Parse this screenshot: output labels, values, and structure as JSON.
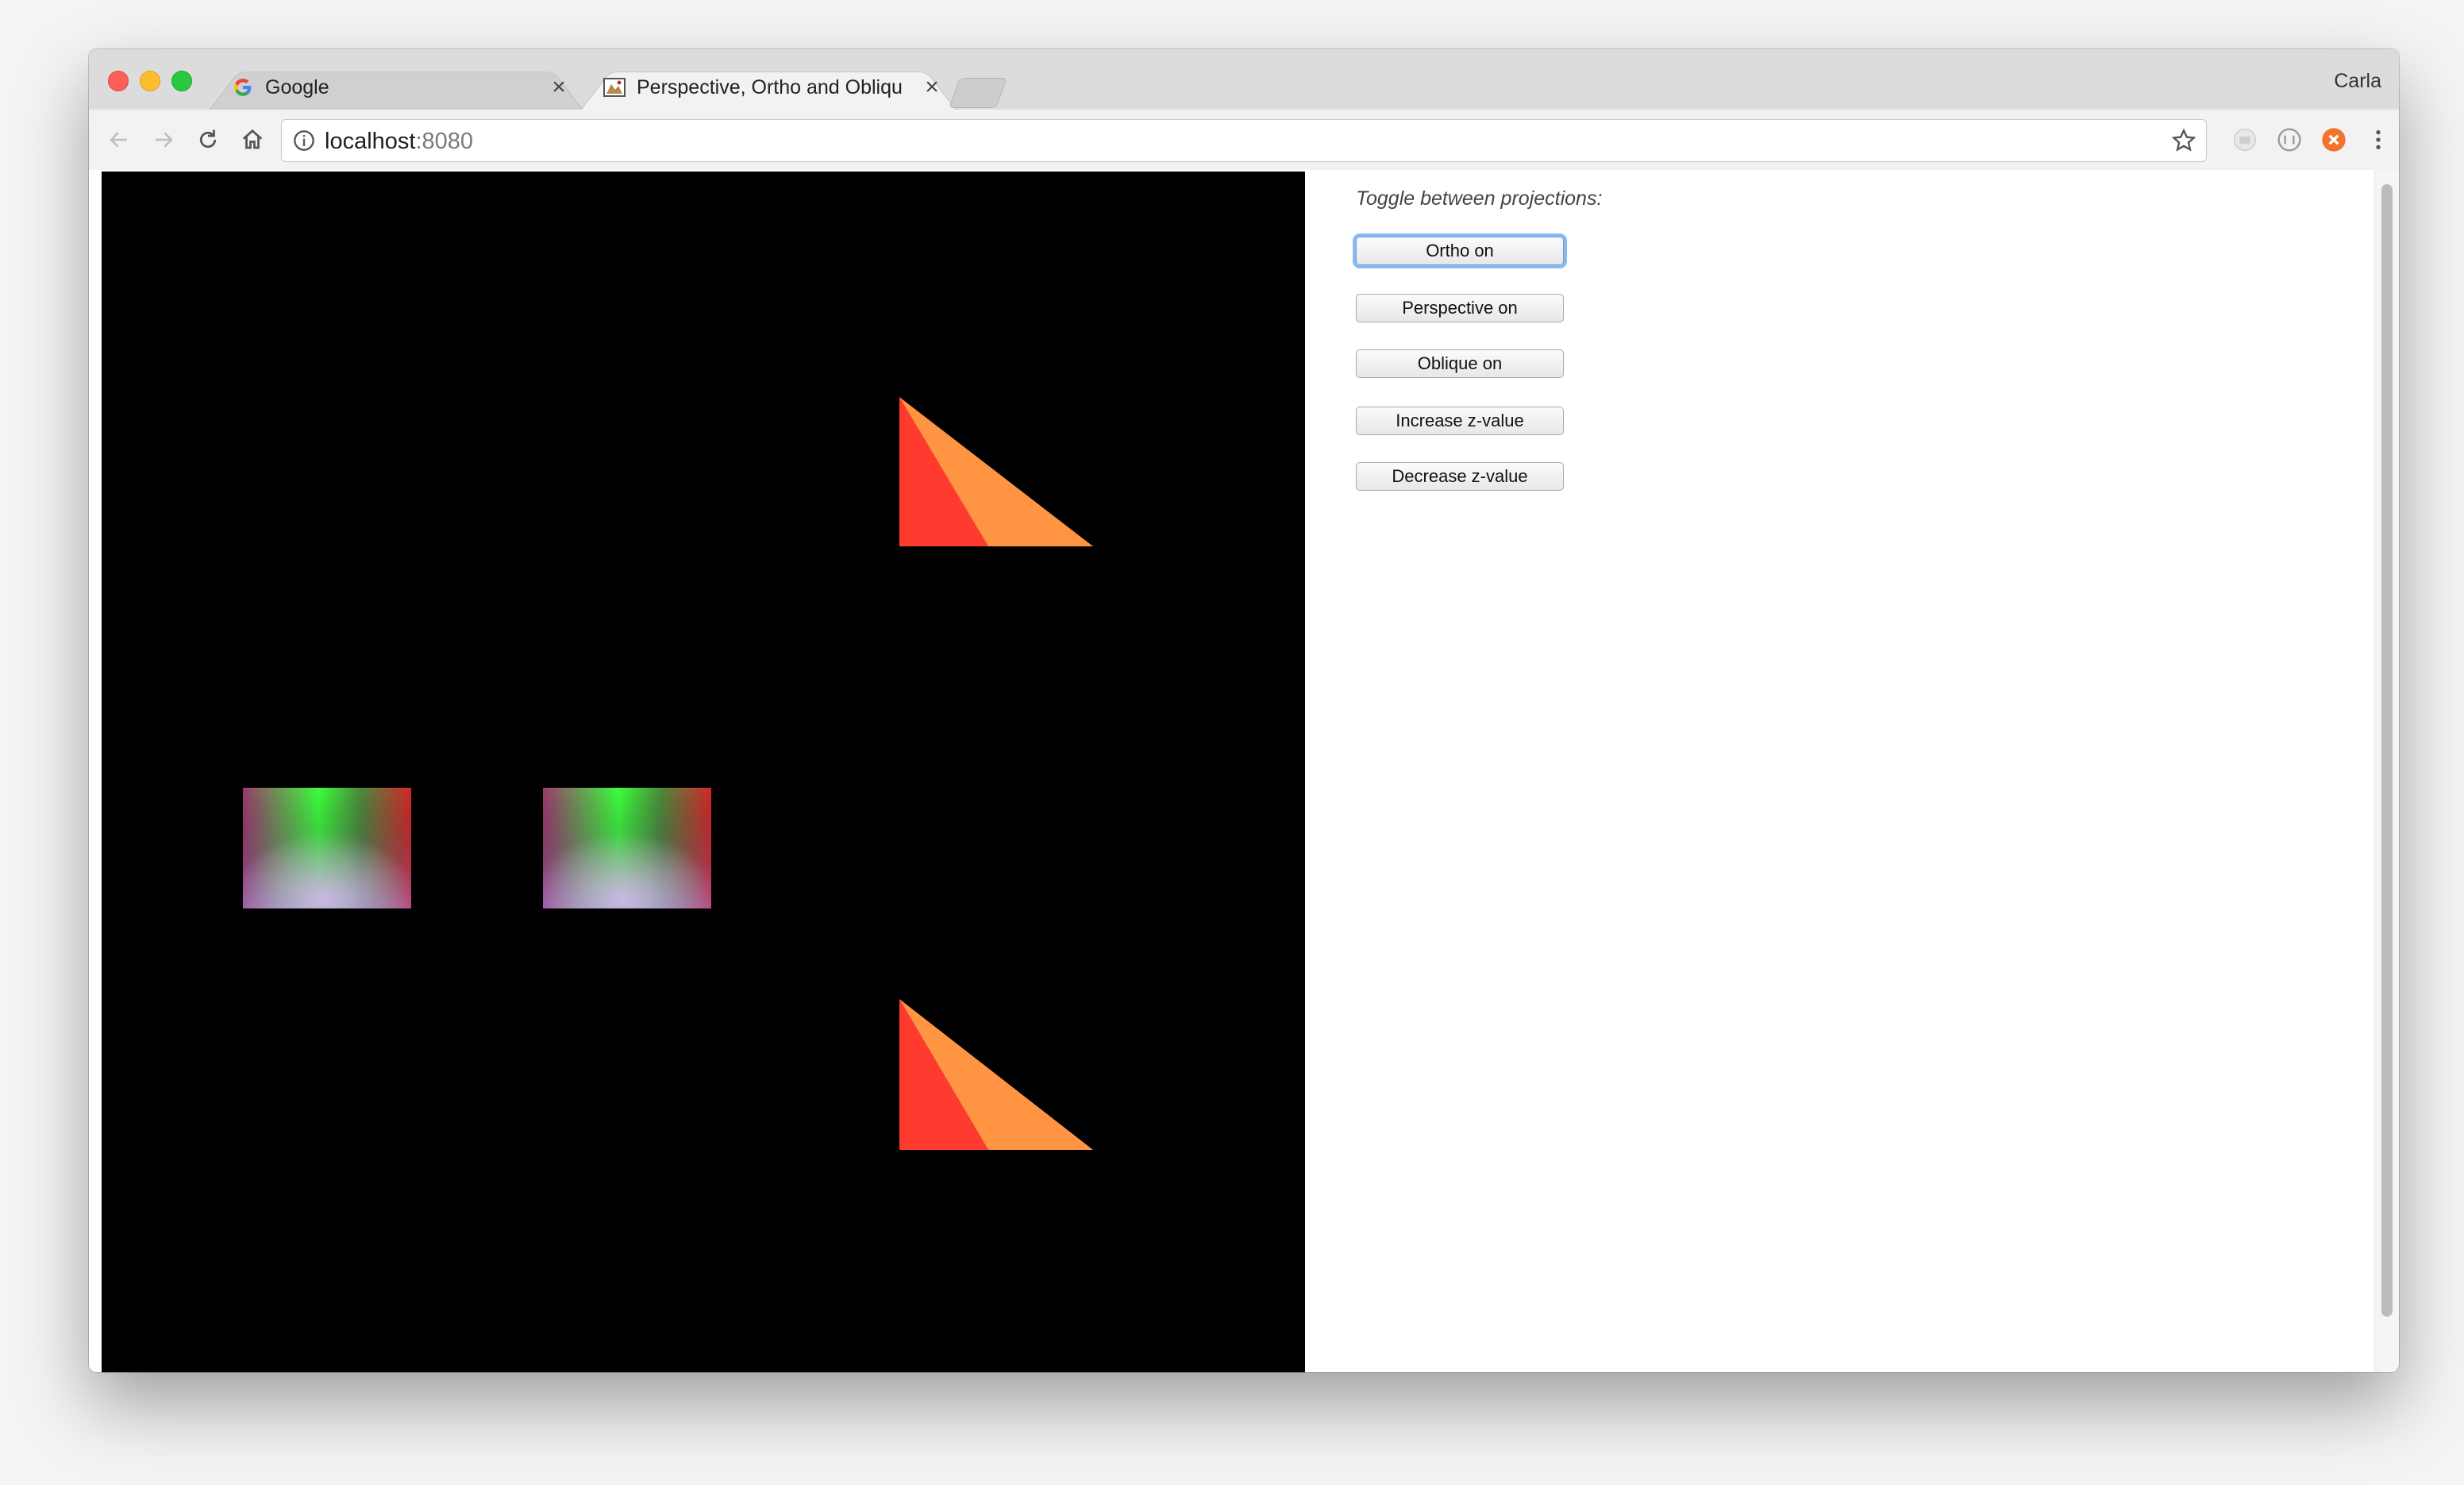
{
  "browser": {
    "tabs": [
      {
        "title": "Google",
        "favicon": "google-g-icon",
        "active": false
      },
      {
        "title": "Perspective, Ortho and Obliqu",
        "favicon": "page-thumbnail-icon",
        "active": true
      }
    ],
    "profile_name": "Carla",
    "address": {
      "host": "localhost",
      "port": ":8080"
    },
    "icons": {
      "back": "arrow-left-icon",
      "forward": "arrow-right-icon",
      "reload": "reload-icon",
      "home": "home-icon",
      "info": "info-icon",
      "bookmark": "star-icon",
      "extensions": [
        "extension-gray-icon",
        "extension-circle-icon",
        "extension-orange-icon"
      ],
      "menu": "kebab-menu-icon"
    }
  },
  "page": {
    "controls_title": "Toggle between projections:",
    "buttons": [
      {
        "label": "Ortho on",
        "focused": true
      },
      {
        "label": "Perspective on",
        "focused": false
      },
      {
        "label": "Oblique on",
        "focused": false
      },
      {
        "label": "Increase z-value",
        "focused": false
      },
      {
        "label": "Decrease z-value",
        "focused": false
      }
    ],
    "scene": {
      "background": "#000000",
      "pyramid_colors": {
        "left_face": "#ff3a2e",
        "right_face": "#ff9542"
      },
      "quad_corner_colors": [
        "#3cff3c",
        "#ff2020",
        "#9a6ad4",
        "#ffffff"
      ]
    }
  }
}
